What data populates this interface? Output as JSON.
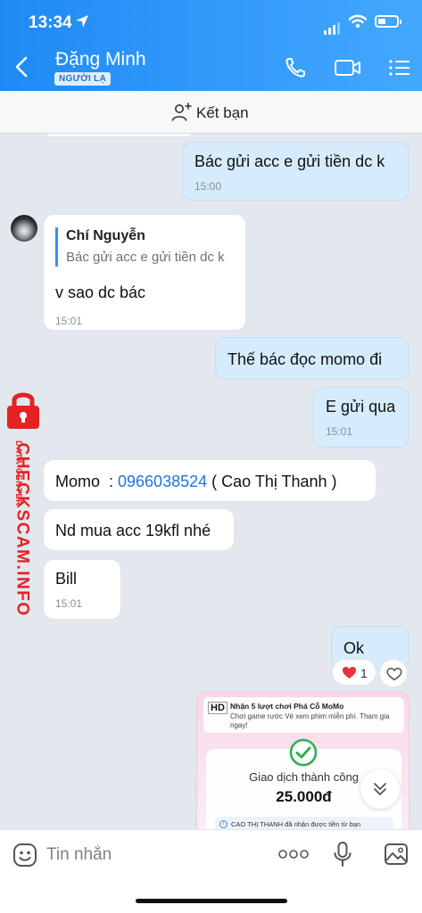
{
  "status_bar": {
    "time": "13:34"
  },
  "header": {
    "contact_name": "Đặng Minh",
    "badge": "NGƯỜI LẠ",
    "icons": [
      "back-icon",
      "phone-icon",
      "video-call-icon",
      "menu-list-icon"
    ]
  },
  "friend_bar": {
    "label": "Kết bạn",
    "icon": "add-friend-icon"
  },
  "messages": [
    {
      "direction": "out",
      "text": "Bác gửi acc e gửi tiền dc k",
      "time": "15:00"
    },
    {
      "direction": "in",
      "reply_to_name": "Chí Nguyễn",
      "reply_to_text": "Bác gửi acc e gửi tiền dc k",
      "text": "v sao dc bác",
      "time": "15:01"
    },
    {
      "direction": "out",
      "text": "Thế bác đọc momo đi"
    },
    {
      "direction": "out",
      "text": "E gửi qua",
      "time": "15:01"
    },
    {
      "direction": "in",
      "text_prefix": "Momo  : ",
      "link_text": "0966038524",
      "text_suffix": " ( Cao Thị Thanh )"
    },
    {
      "direction": "in",
      "text": "Nd mua acc 19kfl nhé"
    },
    {
      "direction": "in",
      "text": "Bill",
      "time": "15:01"
    },
    {
      "direction": "out",
      "text": "Ok",
      "reaction": {
        "emoji": "heart",
        "count": "1"
      }
    }
  ],
  "receipt_image": {
    "hd_tag": "HD",
    "promo_title": "Nhận 5 lượt chơi Phá Cỗ MoMo",
    "promo_subtitle": "Chơi game rước Vé xem phim miễn phí. Tham gia ngay!",
    "status": "Giao dịch thành công",
    "amount": "25.000đ",
    "note": "CAO THỊ THANH đã nhận được tiền từ bạn"
  },
  "watermark": {
    "brand": "CHECKSCAM.INFO",
    "sub": "DATA CENTER"
  },
  "input_bar": {
    "placeholder": "Tin nhắn",
    "more_label": "ooo"
  },
  "colors": {
    "header_start": "#1f8af5",
    "header_end": "#43a8ff",
    "outgoing_bubble": "#d6ebfb",
    "link": "#1e74e0",
    "watermark": "#e52222"
  }
}
